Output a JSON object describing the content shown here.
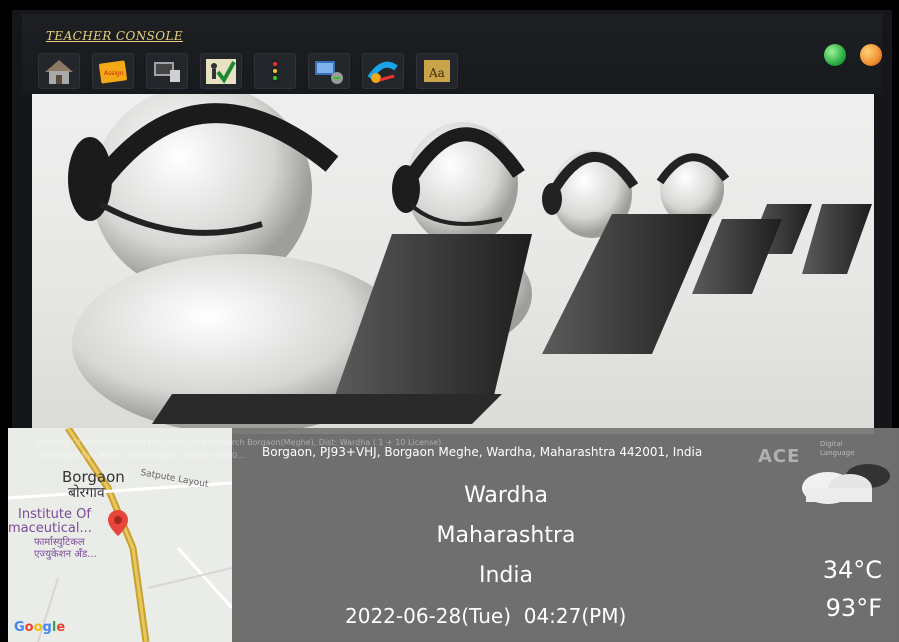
{
  "console": {
    "title": "TEACHER CONSOLE",
    "toolbar": [
      {
        "name": "home",
        "icon": "home-icon"
      },
      {
        "name": "assignment",
        "icon": "assignment-note-icon"
      },
      {
        "name": "pc-share",
        "icon": "computer-icon"
      },
      {
        "name": "check-action",
        "icon": "checkmark-icon"
      },
      {
        "name": "traffic-light",
        "icon": "traffic-light-icon"
      },
      {
        "name": "network",
        "icon": "network-computer-icon"
      },
      {
        "name": "broadcast",
        "icon": "broadcast-icon"
      },
      {
        "name": "font",
        "icon": "font-icon"
      }
    ]
  },
  "address_line": "Borgaon, PJ93+VHJ, Borgaon Meghe, Wardha, Maharashtra 442001, India",
  "faint_text": {
    "licence": "Institute Of Pharmaceutical Education and Research Borgaon(Meghe), Dist: Wardha ( 1 + 10 License)",
    "developer": "Developed By : Biyani Technologies, Contact 8600..."
  },
  "brand": {
    "name": "ACE",
    "sub_line1": "Digital",
    "sub_line2": "Language"
  },
  "map": {
    "label_borgaon_en": "Borgaon",
    "label_borgaon_hi": "बोरगाव",
    "label_satpute": "Satpute Layout",
    "label_institute1": "Institute Of",
    "label_institute2": "maceutical...",
    "label_institute3": "फार्मास्युटिकल",
    "label_institute4": "एज्युकेशन अँड...",
    "google_g": "G",
    "google_o1": "o",
    "google_o2": "o",
    "google_g2": "g",
    "google_l": "l",
    "google_e": "e"
  },
  "location": {
    "city": "Wardha",
    "state": "Maharashtra",
    "country": "India"
  },
  "datetime": {
    "date": "2022-06-28(Tue)",
    "time": "04:27(PM)"
  },
  "weather": {
    "temp_c": "34°C",
    "temp_f": "93°F",
    "icon": "cloud-icon"
  },
  "colors": {
    "title_color": "#e9d27a",
    "min_button": "#23a93b",
    "close_button": "#f08a2a"
  }
}
